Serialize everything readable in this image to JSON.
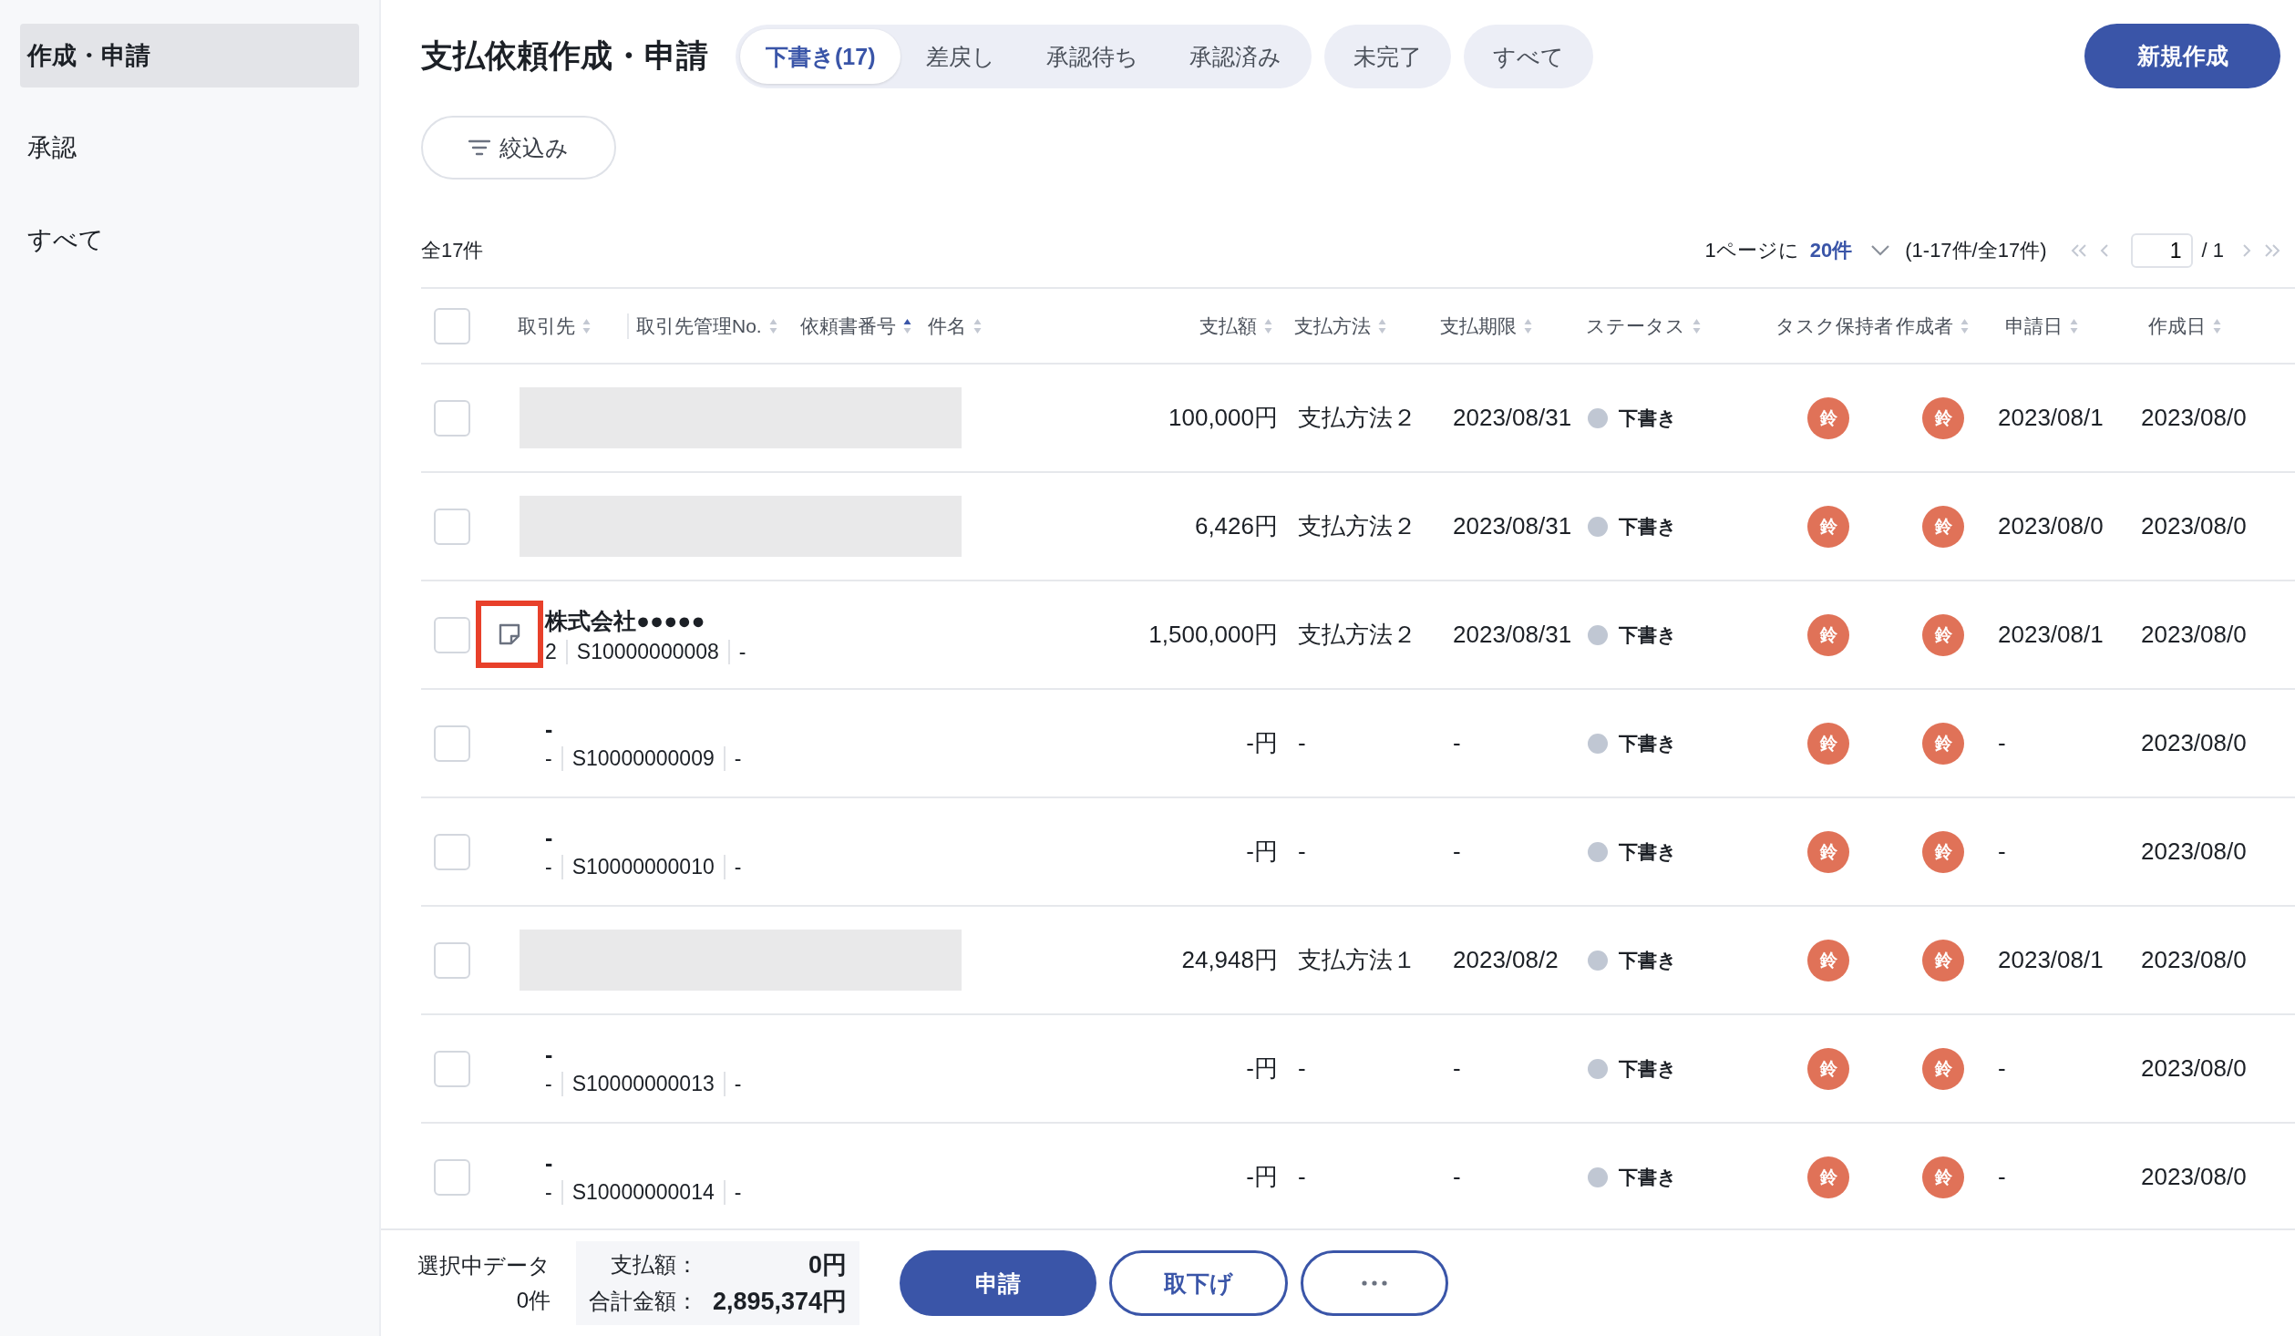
{
  "sidebar": {
    "items": [
      {
        "label": "作成・申請",
        "selected": true
      },
      {
        "label": "承認",
        "selected": false
      },
      {
        "label": "すべて",
        "selected": false
      }
    ]
  },
  "page_title": "支払依頼作成・申請",
  "tabs": [
    {
      "label": "下書き(17)",
      "selected": true,
      "kind": "segment"
    },
    {
      "label": "差戻し",
      "selected": false,
      "kind": "segment"
    },
    {
      "label": "承認待ち",
      "selected": false,
      "kind": "segment"
    },
    {
      "label": "承認済み",
      "selected": false,
      "kind": "segment"
    },
    {
      "label": "未完了",
      "selected": false,
      "kind": "pill"
    },
    {
      "label": "すべて",
      "selected": false,
      "kind": "pill"
    }
  ],
  "new_button": "新規作成",
  "filter_button": "絞込み",
  "total_count": "全17件",
  "pagination": {
    "per_page_label": "1ページに",
    "per_page": "20件",
    "range": "(1-17件/全17件)",
    "page": "1",
    "of_pages": "/ 1"
  },
  "table": {
    "select_all": {
      "checked": false
    },
    "columns": [
      {
        "label": "取引先",
        "sorted": false
      },
      {
        "label": "取引先管理No.",
        "sorted": false
      },
      {
        "label": "依頼書番号",
        "sorted": true
      },
      {
        "label": "件名",
        "sorted": false
      },
      {
        "label": "支払額",
        "sorted": false
      },
      {
        "label": "支払方法",
        "sorted": false
      },
      {
        "label": "支払期限",
        "sorted": false
      },
      {
        "label": "ステータス",
        "sorted": false
      },
      {
        "label": "タスク保持者"
      },
      {
        "label": "作成者",
        "sorted": false
      },
      {
        "label": "申請日",
        "sorted": false
      },
      {
        "label": "作成日",
        "sorted": false
      }
    ],
    "rows": [
      {
        "kind": "redacted",
        "checked": false,
        "note": false,
        "amount": "100,000円",
        "method": "支払方法２",
        "deadline": "2023/08/31",
        "status": "下書き",
        "task_holder": "鈴",
        "creator": "鈴",
        "applied": "2023/08/1",
        "created": "2023/08/0"
      },
      {
        "kind": "redacted",
        "checked": false,
        "note": false,
        "amount": "6,426円",
        "method": "支払方法２",
        "deadline": "2023/08/31",
        "status": "下書き",
        "task_holder": "鈴",
        "creator": "鈴",
        "applied": "2023/08/0",
        "created": "2023/08/0"
      },
      {
        "kind": "detail",
        "checked": false,
        "note": true,
        "name": "株式会社●●●●●",
        "sub": [
          "2",
          "S10000000008",
          "-"
        ],
        "amount": "1,500,000円",
        "method": "支払方法２",
        "deadline": "2023/08/31",
        "status": "下書き",
        "task_holder": "鈴",
        "creator": "鈴",
        "applied": "2023/08/1",
        "created": "2023/08/0"
      },
      {
        "kind": "detail",
        "checked": false,
        "note": false,
        "name": "-",
        "sub": [
          "-",
          "S10000000009",
          "-"
        ],
        "amount": "-円",
        "method": "-",
        "deadline": "-",
        "status": "下書き",
        "task_holder": "鈴",
        "creator": "鈴",
        "applied": "-",
        "created": "2023/08/0"
      },
      {
        "kind": "detail",
        "checked": false,
        "note": false,
        "name": "-",
        "sub": [
          "-",
          "S10000000010",
          "-"
        ],
        "amount": "-円",
        "method": "-",
        "deadline": "-",
        "status": "下書き",
        "task_holder": "鈴",
        "creator": "鈴",
        "applied": "-",
        "created": "2023/08/0"
      },
      {
        "kind": "redacted",
        "checked": false,
        "note": false,
        "amount": "24,948円",
        "method": "支払方法１",
        "deadline": "2023/08/2",
        "status": "下書き",
        "task_holder": "鈴",
        "creator": "鈴",
        "applied": "2023/08/1",
        "created": "2023/08/0"
      },
      {
        "kind": "detail",
        "checked": false,
        "note": false,
        "name": "-",
        "sub": [
          "-",
          "S10000000013",
          "-"
        ],
        "amount": "-円",
        "method": "-",
        "deadline": "-",
        "status": "下書き",
        "task_holder": "鈴",
        "creator": "鈴",
        "applied": "-",
        "created": "2023/08/0"
      },
      {
        "kind": "detail",
        "checked": false,
        "note": false,
        "name": "-",
        "sub": [
          "-",
          "S10000000014",
          "-"
        ],
        "amount": "-円",
        "method": "-",
        "deadline": "-",
        "status": "下書き",
        "task_holder": "鈴",
        "creator": "鈴",
        "applied": "-",
        "created": "2023/08/0"
      }
    ]
  },
  "footer": {
    "selected_label": "選択中データ",
    "selected_count": "0件",
    "pay_label": "支払額：",
    "pay_value": "0円",
    "total_label": "合計金額：",
    "total_value": "2,895,374円",
    "buttons": [
      {
        "label": "申請",
        "kind": "primary"
      },
      {
        "label": "取下げ",
        "kind": "outline"
      },
      {
        "kind": "more"
      }
    ]
  }
}
